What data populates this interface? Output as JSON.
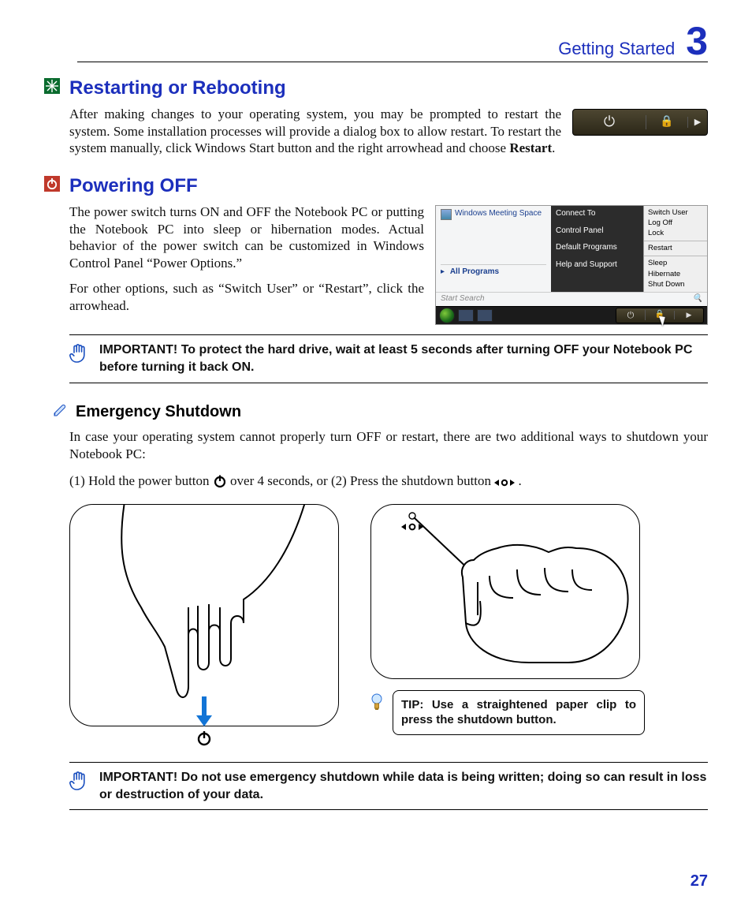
{
  "header": {
    "title": "Getting Started",
    "chapter": "3"
  },
  "s1": {
    "heading": "Restarting or Rebooting",
    "body": "After making changes to your operating system, you may be prompted to restart the system. Some installation processes will provide a dialog box to allow restart. To restart the system manually, click Windows Start button and the right arrowhead and choose ",
    "body_bold": "Restart",
    "body_tail": "."
  },
  "s2": {
    "heading": "Powering OFF",
    "p1": "The power switch turns ON and OFF the Notebook PC or putting the Notebook PC into sleep or hibernation modes. Actual behavior of the power switch can be customized in Windows Control Panel “Power Options.”",
    "p2": "For other options, such as “Switch User” or “Restart”, click the arrowhead."
  },
  "startmenu": {
    "left_top": "Windows Meeting Space",
    "left_all": "All Programs",
    "search": "Start Search",
    "mid": [
      "Connect To",
      "Control Panel",
      "Default Programs",
      "Help and Support"
    ],
    "right": [
      "Switch User",
      "Log Off",
      "Lock",
      "Restart",
      "Sleep",
      "Hibernate",
      "Shut Down"
    ]
  },
  "important1": "IMPORTANT!  To protect the hard drive, wait at least 5 seconds after turning OFF your Notebook PC before turning it back ON.",
  "s3": {
    "heading": "Emergency Shutdown",
    "body": "In case your operating system cannot properly turn OFF or restart, there are two additional ways to shutdown your Notebook PC:",
    "m1a": "(1) Hold the power button ",
    "m1b": " over 4 seconds, or",
    "m2a": "  (2) Press the shutdown button ",
    "m2b": "."
  },
  "tip": "TIP: Use a straightened paper clip to press the shutdown button.",
  "important2": "IMPORTANT!  Do not use emergency shutdown while data is being written; doing so can result in loss or destruction of your data.",
  "page": "27"
}
